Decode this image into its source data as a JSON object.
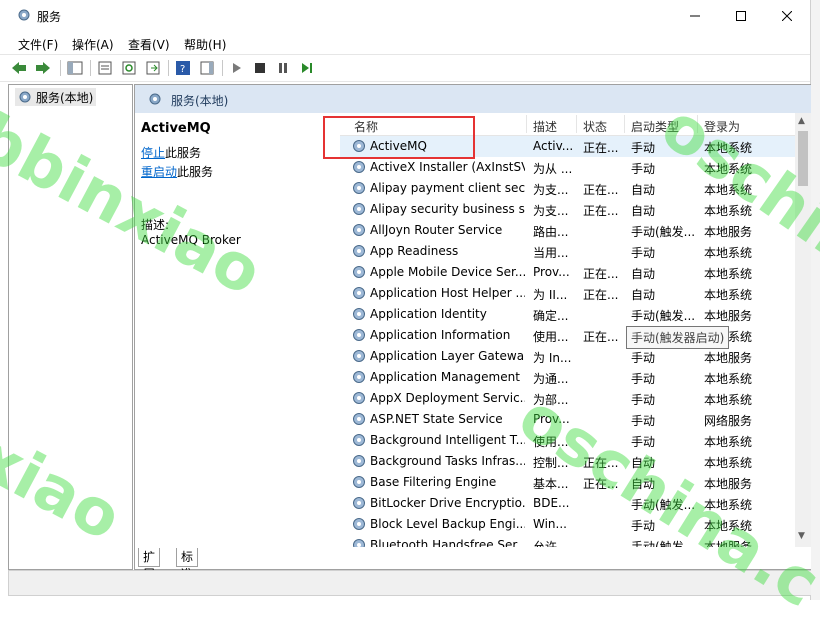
{
  "window": {
    "title": "服务"
  },
  "menu": [
    "文件(F)",
    "操作(A)",
    "查看(V)",
    "帮助(H)"
  ],
  "tree": {
    "root_label": "服务(本地)"
  },
  "pane": {
    "header": "服务(本地)"
  },
  "description": {
    "service_title": "ActiveMQ",
    "stop_link": "停止",
    "stop_suffix": "此服务",
    "restart_link": "重启动",
    "restart_suffix": "此服务",
    "desc_label": "描述:",
    "desc_value": "ActiveMQ Broker"
  },
  "table": {
    "columns": [
      "名称",
      "描述",
      "状态",
      "启动类型",
      "登录为"
    ],
    "rows": [
      {
        "name": "ActiveMQ",
        "desc": "Activ...",
        "state": "正在...",
        "start": "手动",
        "logon": "本地系统"
      },
      {
        "name": "ActiveX Installer (AxInstSV)",
        "desc": "为从 ...",
        "state": "",
        "start": "手动",
        "logon": "本地系统"
      },
      {
        "name": "Alipay payment client sec...",
        "desc": "为支...",
        "state": "正在...",
        "start": "自动",
        "logon": "本地系统"
      },
      {
        "name": "Alipay security business s...",
        "desc": "为支...",
        "state": "正在...",
        "start": "自动",
        "logon": "本地系统"
      },
      {
        "name": "AllJoyn Router Service",
        "desc": "路由...",
        "state": "",
        "start": "手动(触发...",
        "logon": "本地服务"
      },
      {
        "name": "App Readiness",
        "desc": "当用...",
        "state": "",
        "start": "手动",
        "logon": "本地系统"
      },
      {
        "name": "Apple Mobile Device Ser...",
        "desc": "Prov...",
        "state": "正在...",
        "start": "自动",
        "logon": "本地系统"
      },
      {
        "name": "Application Host Helper ...",
        "desc": "为 II...",
        "state": "正在...",
        "start": "自动",
        "logon": "本地系统"
      },
      {
        "name": "Application Identity",
        "desc": "确定...",
        "state": "",
        "start": "手动(触发...",
        "logon": "本地服务"
      },
      {
        "name": "Application Information",
        "desc": "使用...",
        "state": "正在...",
        "start": "",
        "logon": "本地系统"
      },
      {
        "name": "Application Layer Gatewa...",
        "desc": "为 In...",
        "state": "",
        "start": "手动",
        "logon": "本地服务"
      },
      {
        "name": "Application Management",
        "desc": "为通...",
        "state": "",
        "start": "手动",
        "logon": "本地系统"
      },
      {
        "name": "AppX Deployment Servic...",
        "desc": "为部...",
        "state": "",
        "start": "手动",
        "logon": "本地系统"
      },
      {
        "name": "ASP.NET State Service",
        "desc": "Prov...",
        "state": "",
        "start": "手动",
        "logon": "网络服务"
      },
      {
        "name": "Background Intelligent T...",
        "desc": "使用...",
        "state": "",
        "start": "手动",
        "logon": "本地系统"
      },
      {
        "name": "Background Tasks Infras...",
        "desc": "控制...",
        "state": "正在...",
        "start": "自动",
        "logon": "本地系统"
      },
      {
        "name": "Base Filtering Engine",
        "desc": "基本...",
        "state": "正在...",
        "start": "自动",
        "logon": "本地服务"
      },
      {
        "name": "BitLocker Drive Encryptio...",
        "desc": "BDE...",
        "state": "",
        "start": "手动(触发...",
        "logon": "本地系统"
      },
      {
        "name": "Block Level Backup Engi...",
        "desc": "Win...",
        "state": "",
        "start": "手动",
        "logon": "本地系统"
      },
      {
        "name": "Bluetooth Handsfree Ser...",
        "desc": "允许...",
        "state": "",
        "start": "手动(触发...",
        "logon": "本地服务"
      }
    ]
  },
  "tooltip": "手动(触发器启动)",
  "tabs": [
    "扩展",
    "标准"
  ],
  "watermarks": [
    "bbinxiao",
    "oschina",
    "xiao",
    "oschina.c"
  ]
}
